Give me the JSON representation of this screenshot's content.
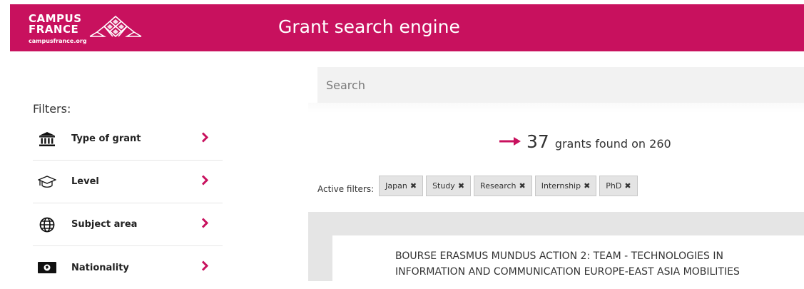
{
  "header": {
    "logo_line1": "CAMPUS",
    "logo_line2": "FRANCE",
    "logo_url": "campusfrance.org",
    "title": "Grant search engine"
  },
  "sidebar": {
    "filters_label": "Filters:",
    "items": [
      {
        "label": "Type of grant",
        "icon": "institution-icon"
      },
      {
        "label": "Level",
        "icon": "graduation-cap-icon"
      },
      {
        "label": "Subject area",
        "icon": "globe-icon"
      },
      {
        "label": "Nationality",
        "icon": "id-card-icon"
      }
    ]
  },
  "search": {
    "placeholder": "Search",
    "value": ""
  },
  "results": {
    "count": "37",
    "suffix": "grants found on 260"
  },
  "active_filters": {
    "label": "Active filters:",
    "chips": [
      "Japan",
      "Study",
      "Research",
      "Internship",
      "PhD"
    ]
  },
  "grant_list": [
    {
      "title": "BOURSE ERASMUS MUNDUS ACTION 2: TEAM - TECHNOLOGIES IN INFORMATION AND COMMUNICATION EUROPE-EAST ASIA MOBILITIES"
    }
  ],
  "colors": {
    "brand": "#c8115e",
    "panel": "#e5e5e5",
    "chip": "#e4e4e4"
  }
}
